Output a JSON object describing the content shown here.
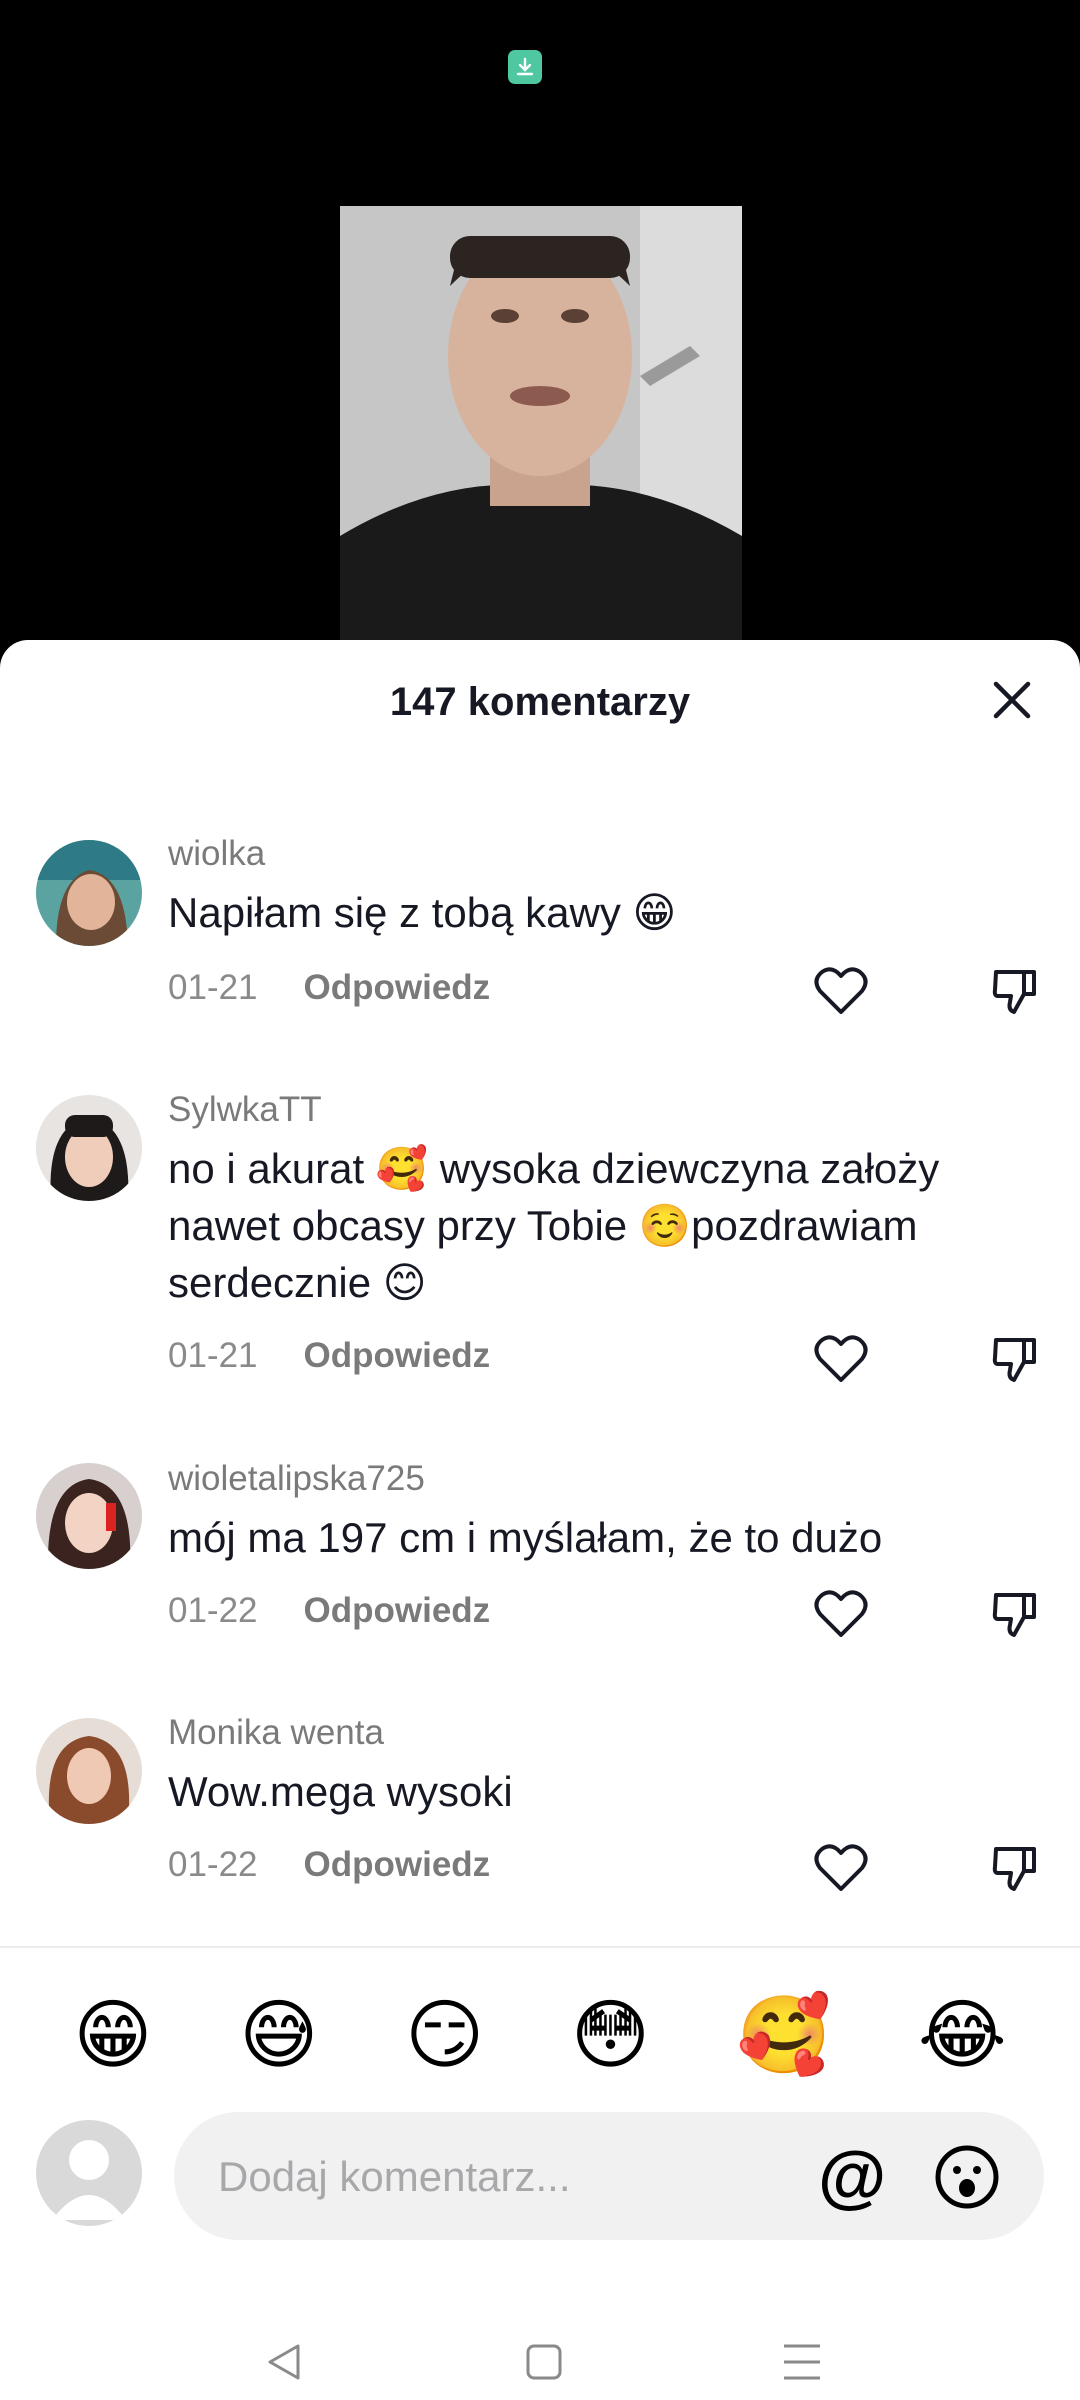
{
  "sheet": {
    "title": "147 komentarzy"
  },
  "comments": [
    {
      "username": "wiolka",
      "text": "Napiłam się z tobą kawy 😁",
      "date": "01-21",
      "reply": "Odpowiedz"
    },
    {
      "username": "SylwkaTT",
      "text": "no i akurat 🥰 wysoka dziewczyna założy nawet obcasy przy Tobie ☺️pozdrawiam serdecznie 😊",
      "date": "01-21",
      "reply": "Odpowiedz"
    },
    {
      "username": "wioletalipska725",
      "text": "mój ma 197 cm i myślałam, że to dużo",
      "date": "01-22",
      "reply": "Odpowiedz"
    },
    {
      "username": "Monika wenta",
      "text": "Wow.mega wysoki",
      "date": "01-22",
      "reply": "Odpowiedz"
    }
  ],
  "quick_emojis": [
    "😁",
    "😅",
    "😏",
    "😳",
    "🥰",
    "😂"
  ],
  "composer": {
    "placeholder": "Dodaj komentarz...",
    "at_symbol": "@"
  },
  "colors": {
    "accent_download": "#4fc7a0",
    "text_primary": "#161823",
    "text_secondary": "#7a7a7a"
  }
}
